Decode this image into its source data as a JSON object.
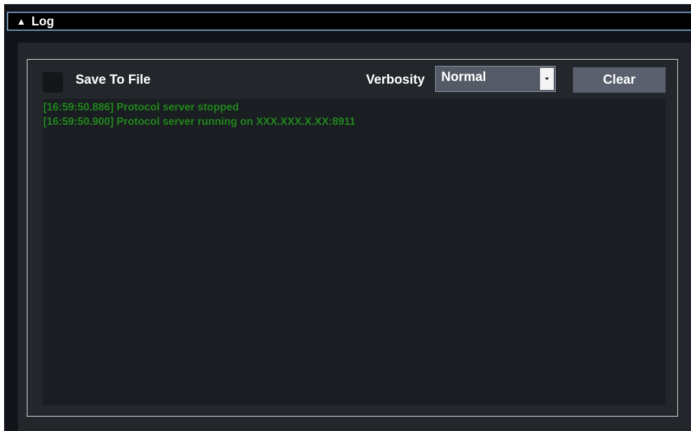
{
  "panel": {
    "collapse_glyph": "▲",
    "title": "Log"
  },
  "controls": {
    "save_to_file_label": "Save To File",
    "save_to_file_checked": false,
    "verbosity_label": "Verbosity",
    "verbosity_value": "Normal",
    "clear_label": "Clear"
  },
  "log": {
    "lines": [
      "[16:59:50.886] Protocol server stopped",
      "[16:59:50.900] Protocol server running on XXX.XXX.X.XX:8911"
    ]
  },
  "colors": {
    "log_text": "#20861c",
    "header_border": "#6e8fb3",
    "background": "#23272c"
  }
}
